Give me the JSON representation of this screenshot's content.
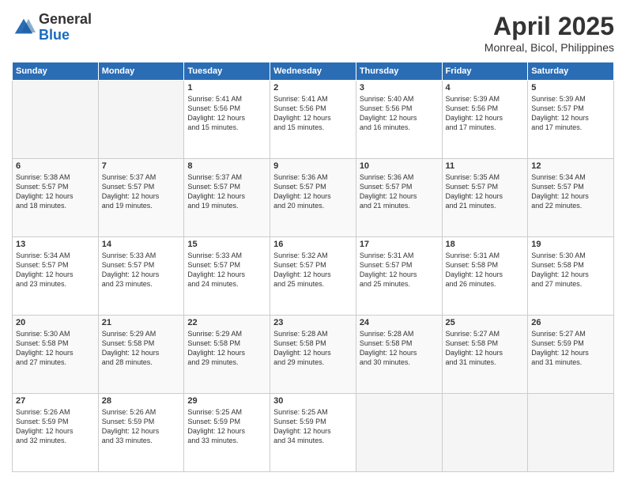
{
  "logo": {
    "general": "General",
    "blue": "Blue"
  },
  "title": "April 2025",
  "location": "Monreal, Bicol, Philippines",
  "days_header": [
    "Sunday",
    "Monday",
    "Tuesday",
    "Wednesday",
    "Thursday",
    "Friday",
    "Saturday"
  ],
  "weeks": [
    [
      {
        "day": "",
        "info": ""
      },
      {
        "day": "",
        "info": ""
      },
      {
        "day": "1",
        "info": "Sunrise: 5:41 AM\nSunset: 5:56 PM\nDaylight: 12 hours\nand 15 minutes."
      },
      {
        "day": "2",
        "info": "Sunrise: 5:41 AM\nSunset: 5:56 PM\nDaylight: 12 hours\nand 15 minutes."
      },
      {
        "day": "3",
        "info": "Sunrise: 5:40 AM\nSunset: 5:56 PM\nDaylight: 12 hours\nand 16 minutes."
      },
      {
        "day": "4",
        "info": "Sunrise: 5:39 AM\nSunset: 5:56 PM\nDaylight: 12 hours\nand 17 minutes."
      },
      {
        "day": "5",
        "info": "Sunrise: 5:39 AM\nSunset: 5:57 PM\nDaylight: 12 hours\nand 17 minutes."
      }
    ],
    [
      {
        "day": "6",
        "info": "Sunrise: 5:38 AM\nSunset: 5:57 PM\nDaylight: 12 hours\nand 18 minutes."
      },
      {
        "day": "7",
        "info": "Sunrise: 5:37 AM\nSunset: 5:57 PM\nDaylight: 12 hours\nand 19 minutes."
      },
      {
        "day": "8",
        "info": "Sunrise: 5:37 AM\nSunset: 5:57 PM\nDaylight: 12 hours\nand 19 minutes."
      },
      {
        "day": "9",
        "info": "Sunrise: 5:36 AM\nSunset: 5:57 PM\nDaylight: 12 hours\nand 20 minutes."
      },
      {
        "day": "10",
        "info": "Sunrise: 5:36 AM\nSunset: 5:57 PM\nDaylight: 12 hours\nand 21 minutes."
      },
      {
        "day": "11",
        "info": "Sunrise: 5:35 AM\nSunset: 5:57 PM\nDaylight: 12 hours\nand 21 minutes."
      },
      {
        "day": "12",
        "info": "Sunrise: 5:34 AM\nSunset: 5:57 PM\nDaylight: 12 hours\nand 22 minutes."
      }
    ],
    [
      {
        "day": "13",
        "info": "Sunrise: 5:34 AM\nSunset: 5:57 PM\nDaylight: 12 hours\nand 23 minutes."
      },
      {
        "day": "14",
        "info": "Sunrise: 5:33 AM\nSunset: 5:57 PM\nDaylight: 12 hours\nand 23 minutes."
      },
      {
        "day": "15",
        "info": "Sunrise: 5:33 AM\nSunset: 5:57 PM\nDaylight: 12 hours\nand 24 minutes."
      },
      {
        "day": "16",
        "info": "Sunrise: 5:32 AM\nSunset: 5:57 PM\nDaylight: 12 hours\nand 25 minutes."
      },
      {
        "day": "17",
        "info": "Sunrise: 5:31 AM\nSunset: 5:57 PM\nDaylight: 12 hours\nand 25 minutes."
      },
      {
        "day": "18",
        "info": "Sunrise: 5:31 AM\nSunset: 5:58 PM\nDaylight: 12 hours\nand 26 minutes."
      },
      {
        "day": "19",
        "info": "Sunrise: 5:30 AM\nSunset: 5:58 PM\nDaylight: 12 hours\nand 27 minutes."
      }
    ],
    [
      {
        "day": "20",
        "info": "Sunrise: 5:30 AM\nSunset: 5:58 PM\nDaylight: 12 hours\nand 27 minutes."
      },
      {
        "day": "21",
        "info": "Sunrise: 5:29 AM\nSunset: 5:58 PM\nDaylight: 12 hours\nand 28 minutes."
      },
      {
        "day": "22",
        "info": "Sunrise: 5:29 AM\nSunset: 5:58 PM\nDaylight: 12 hours\nand 29 minutes."
      },
      {
        "day": "23",
        "info": "Sunrise: 5:28 AM\nSunset: 5:58 PM\nDaylight: 12 hours\nand 29 minutes."
      },
      {
        "day": "24",
        "info": "Sunrise: 5:28 AM\nSunset: 5:58 PM\nDaylight: 12 hours\nand 30 minutes."
      },
      {
        "day": "25",
        "info": "Sunrise: 5:27 AM\nSunset: 5:58 PM\nDaylight: 12 hours\nand 31 minutes."
      },
      {
        "day": "26",
        "info": "Sunrise: 5:27 AM\nSunset: 5:59 PM\nDaylight: 12 hours\nand 31 minutes."
      }
    ],
    [
      {
        "day": "27",
        "info": "Sunrise: 5:26 AM\nSunset: 5:59 PM\nDaylight: 12 hours\nand 32 minutes."
      },
      {
        "day": "28",
        "info": "Sunrise: 5:26 AM\nSunset: 5:59 PM\nDaylight: 12 hours\nand 33 minutes."
      },
      {
        "day": "29",
        "info": "Sunrise: 5:25 AM\nSunset: 5:59 PM\nDaylight: 12 hours\nand 33 minutes."
      },
      {
        "day": "30",
        "info": "Sunrise: 5:25 AM\nSunset: 5:59 PM\nDaylight: 12 hours\nand 34 minutes."
      },
      {
        "day": "",
        "info": ""
      },
      {
        "day": "",
        "info": ""
      },
      {
        "day": "",
        "info": ""
      }
    ]
  ]
}
